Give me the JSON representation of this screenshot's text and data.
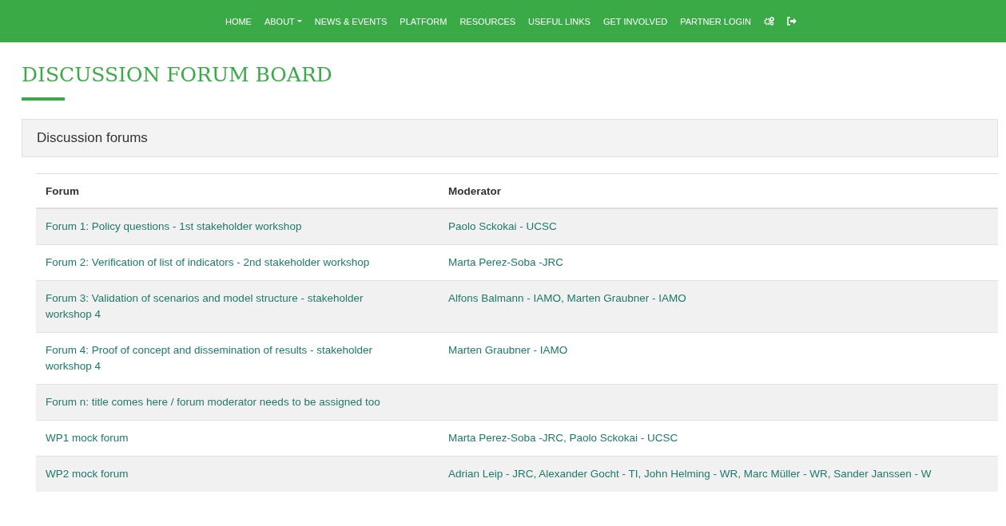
{
  "nav": {
    "items": [
      {
        "label": "HOME",
        "caret": false
      },
      {
        "label": "ABOUT",
        "caret": true
      },
      {
        "label": "NEWS & EVENTS",
        "caret": false
      },
      {
        "label": "PLATFORM",
        "caret": false
      },
      {
        "label": "RESOURCES",
        "caret": false
      },
      {
        "label": "USEFUL LINKS",
        "caret": false
      },
      {
        "label": "GET INVOLVED",
        "caret": false
      },
      {
        "label": "PARTNER LOGIN",
        "caret": false
      }
    ],
    "icons": [
      {
        "kind": "cogs"
      },
      {
        "kind": "sign-out"
      }
    ]
  },
  "page_title": "DISCUSSION FORUM BOARD",
  "panel": {
    "title": "Discussion forums",
    "table": {
      "columns": [
        "Forum",
        "Moderator"
      ],
      "rows": [
        {
          "forum": "Forum 1: Policy questions - 1st stakeholder workshop",
          "moderator": "Paolo Sckokai - UCSC"
        },
        {
          "forum": "Forum 2: Verification of list of indicators - 2nd stakeholder workshop",
          "moderator": "Marta Perez-Soba -JRC"
        },
        {
          "forum": "Forum 3: Validation of scenarios and model structure - stakeholder workshop 4",
          "moderator": "Alfons Balmann - IAMO, Marten Graubner - IAMO"
        },
        {
          "forum": "Forum 4: Proof of concept and dissemination of results - stakeholder workshop 4",
          "moderator": "Marten Graubner - IAMO"
        },
        {
          "forum": "Forum n: title comes here / forum moderator needs to be assigned too",
          "moderator": ""
        },
        {
          "forum": "WP1 mock forum",
          "moderator": "Marta Perez-Soba -JRC, Paolo Sckokai - UCSC"
        },
        {
          "forum": "WP2 mock forum",
          "moderator": "Adrian Leip - JRC, Alexander Gocht - TI, John Helming - WR, Marc Müller - WR, Sander Janssen - W"
        }
      ]
    }
  }
}
